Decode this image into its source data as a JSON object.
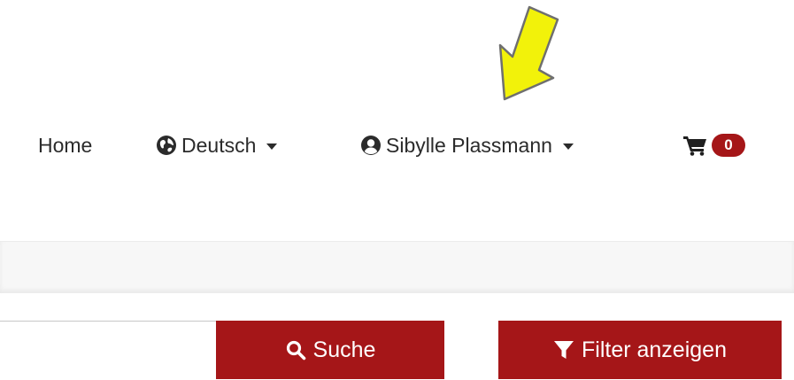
{
  "nav": {
    "home_label": "Home",
    "language_label": "Deutsch",
    "user_label": "Sibylle Plassmann",
    "cart_count": "0"
  },
  "search": {
    "value": "",
    "search_button_label": "Suche",
    "filter_button_label": "Filter anzeigen"
  },
  "colors": {
    "brand": "#a51618",
    "nav_text": "#2b2b2b",
    "annotation_arrow": "#f2f20a"
  },
  "icons": {
    "annotation": "arrow-annotation-icon",
    "language": "globe-icon",
    "user": "user-circle-icon",
    "cart": "cart-icon",
    "search": "search-icon",
    "filter": "filter-icon"
  }
}
